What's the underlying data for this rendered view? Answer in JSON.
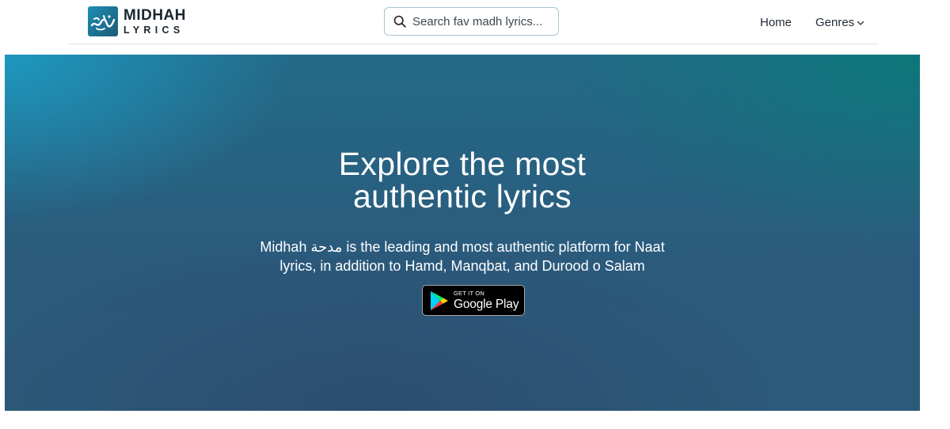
{
  "header": {
    "logo": {
      "line1": "MIDHAH",
      "line2": "LYRICS",
      "icon": "calligraphy-logo-icon"
    },
    "search": {
      "placeholder": "Search fav madh lyrics...",
      "icon": "search-icon"
    },
    "nav": {
      "home_label": "Home",
      "genres_label": "Genres",
      "genres_icon": "chevron-down-icon"
    }
  },
  "hero": {
    "title_line1": "Explore the most",
    "title_line2": "authentic lyrics",
    "subtitle_line1": "Midhah مدحة is the leading and most authentic platform for Naat",
    "subtitle_line2": "lyrics, in addition to Hamd, Manqbat, and Durood o Salam",
    "play_badge": {
      "small": "GET IT ON",
      "big": "Google Play",
      "icon": "google-play-icon"
    }
  },
  "colors": {
    "hero_top_left": "#1da0c8",
    "hero_top_right": "#0b7878",
    "hero_bottom": "#2c5a7a",
    "text_dark": "#1f2937",
    "search_border": "#a9c3d3"
  }
}
